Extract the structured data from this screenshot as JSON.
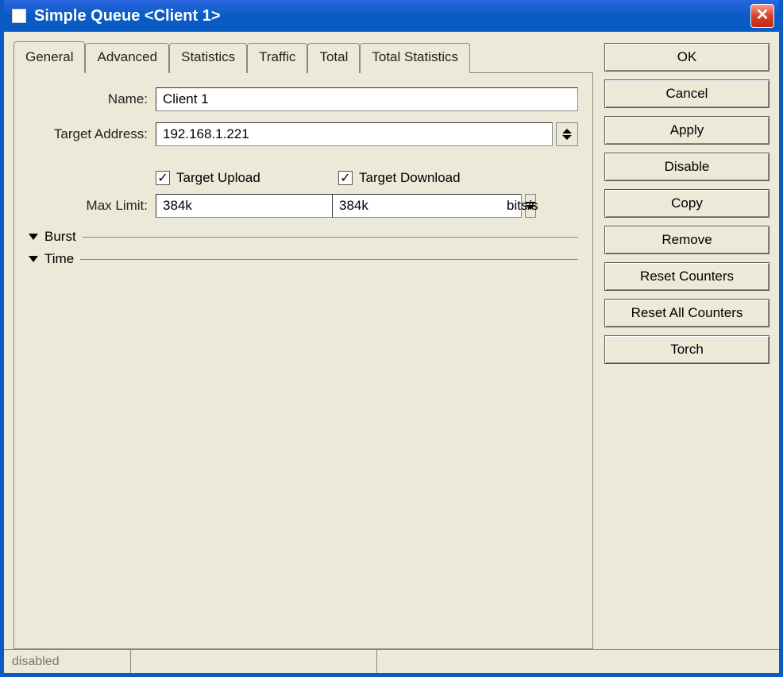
{
  "window": {
    "title": "Simple Queue <Client 1>"
  },
  "tabs": [
    {
      "label": "General"
    },
    {
      "label": "Advanced"
    },
    {
      "label": "Statistics"
    },
    {
      "label": "Traffic"
    },
    {
      "label": "Total"
    },
    {
      "label": "Total Statistics"
    }
  ],
  "form": {
    "name_label": "Name:",
    "name_value": "Client 1",
    "target_address_label": "Target Address:",
    "target_address_value": "192.168.1.221",
    "target_upload_label": "Target Upload",
    "target_upload_checked": true,
    "target_download_label": "Target Download",
    "target_download_checked": true,
    "max_limit_label": "Max Limit:",
    "max_limit_upload": "384k",
    "max_limit_download": "384k",
    "max_limit_unit": "bits/s",
    "burst_label": "Burst",
    "time_label": "Time"
  },
  "buttons": {
    "ok": "OK",
    "cancel": "Cancel",
    "apply": "Apply",
    "disable": "Disable",
    "copy": "Copy",
    "remove": "Remove",
    "reset_counters": "Reset Counters",
    "reset_all_counters": "Reset All Counters",
    "torch": "Torch"
  },
  "status": {
    "state": "disabled"
  }
}
